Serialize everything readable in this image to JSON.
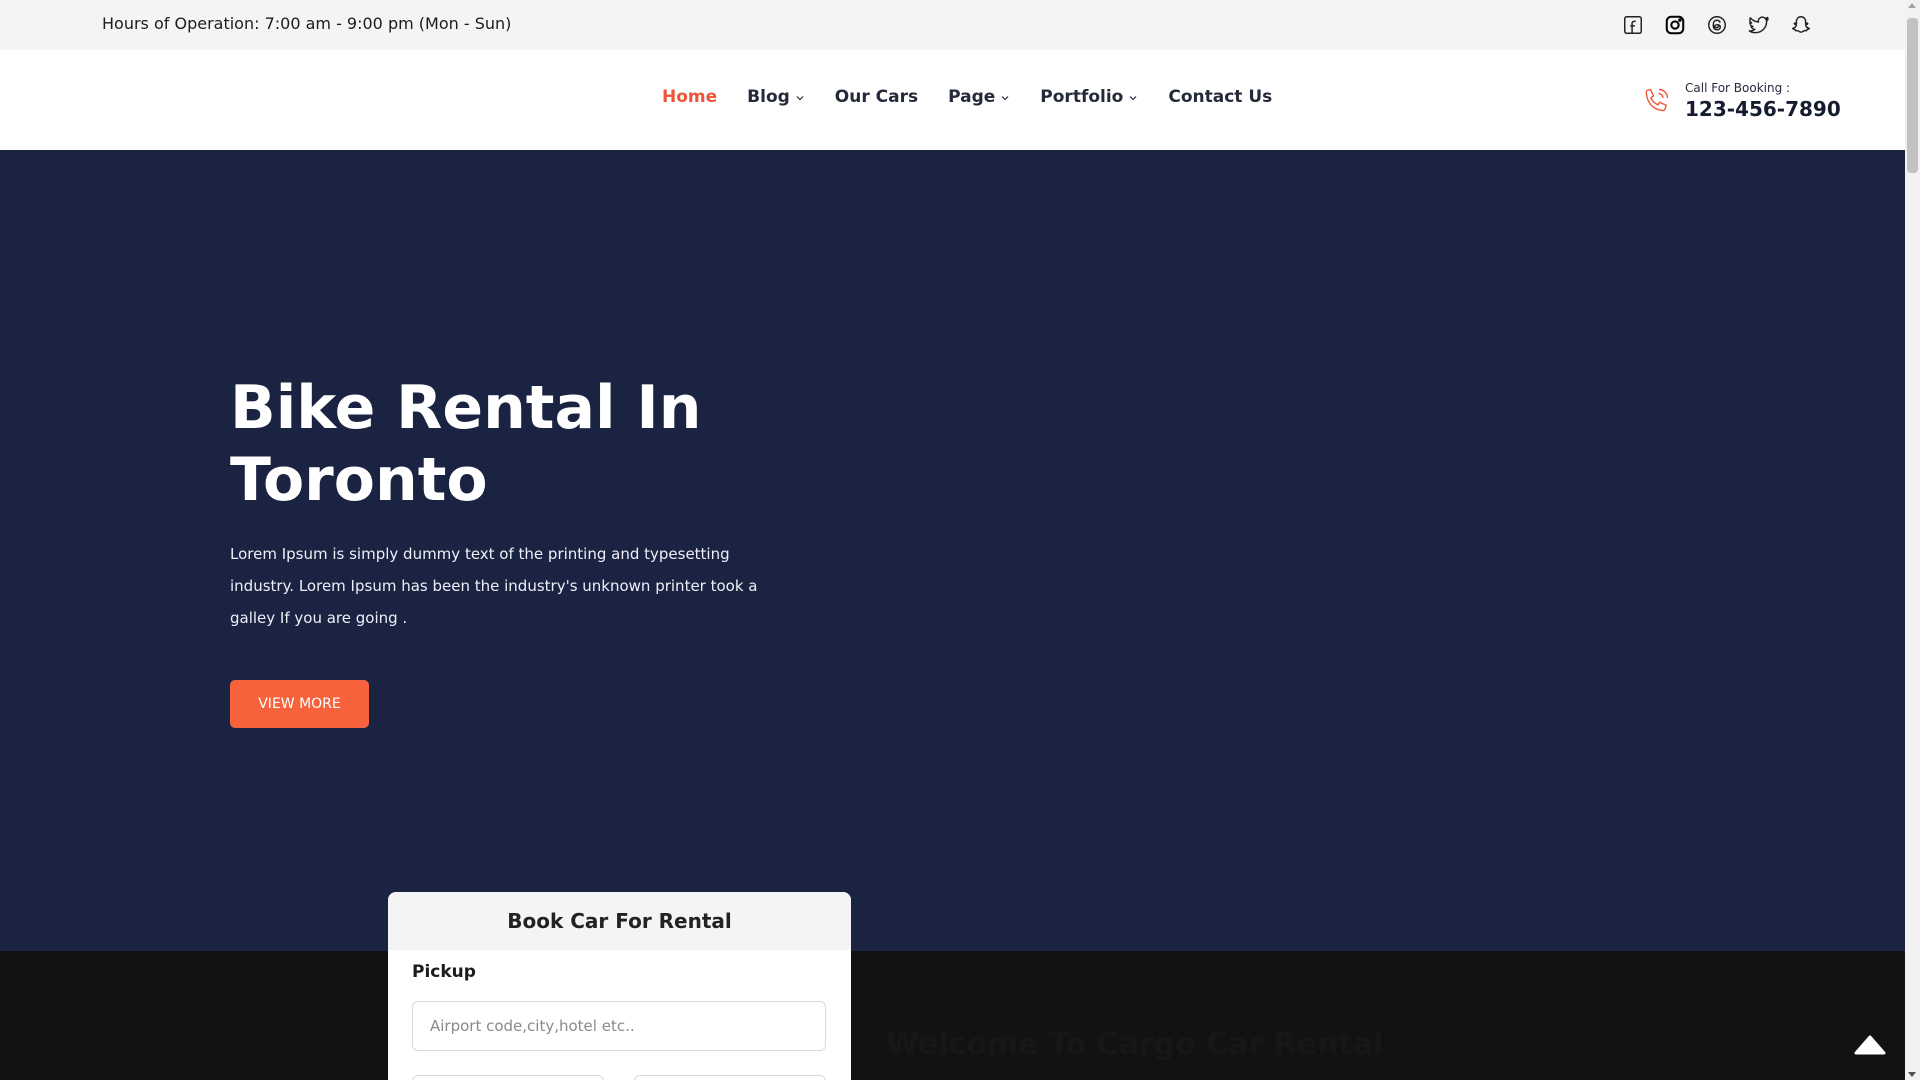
{
  "topbar": {
    "hours": "Hours of Operation: 7:00 am - 9:00 pm (Mon - Sun)",
    "socials": [
      "facebook-icon",
      "instagram-icon",
      "threads-icon",
      "twitter-icon",
      "snapchat-icon"
    ]
  },
  "nav": {
    "items": [
      {
        "label": "Home",
        "active": true,
        "dropdown": false
      },
      {
        "label": "Blog",
        "active": false,
        "dropdown": true
      },
      {
        "label": "Our Cars",
        "active": false,
        "dropdown": false
      },
      {
        "label": "Page",
        "active": false,
        "dropdown": true
      },
      {
        "label": "Portfolio",
        "active": false,
        "dropdown": true
      },
      {
        "label": "Contact Us",
        "active": false,
        "dropdown": false
      }
    ],
    "call_label": "Call For Booking :",
    "call_number": "123-456-7890"
  },
  "hero": {
    "title_line1": "Bike Rental In",
    "title_line2": "Toronto",
    "text": "Lorem Ipsum is simply dummy text of the printing and typesetting industry. Lorem Ipsum has been the industry's unknown printer took a galley If you are going .",
    "button": "VIEW MORE"
  },
  "booking_card": {
    "title": "Book Car For Rental",
    "pickup_label": "Pickup",
    "pickup_placeholder": "Airport code,city,hotel etc.."
  },
  "welcome": {
    "heading": "Welcome To Cargo Car Rental"
  },
  "colors": {
    "accent": "#f0553a",
    "button": "#f5623c",
    "hero_bg": "#1b2343",
    "dark_bg": "#121212"
  }
}
